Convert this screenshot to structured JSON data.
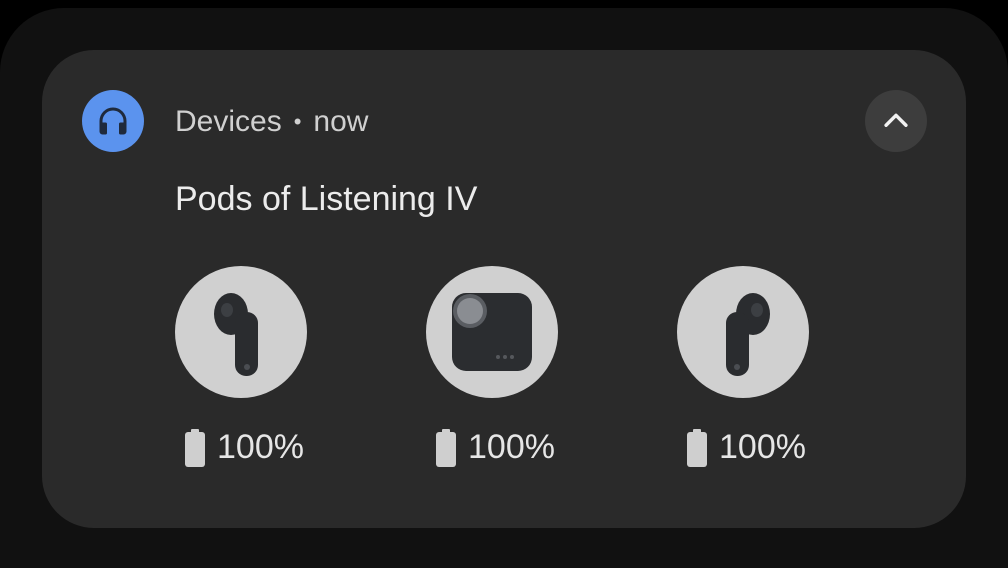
{
  "notification": {
    "app_name": "Devices",
    "separator": "•",
    "time": "now",
    "title": "Pods of Listening IV",
    "app_icon": "headphones-icon",
    "expand_icon": "chevron-up-icon",
    "accent_color": "#5b93ee"
  },
  "devices": [
    {
      "name": "left-earbud",
      "battery_label": "100%",
      "battery_level": 1.0
    },
    {
      "name": "charging-case",
      "battery_label": "100%",
      "battery_level": 1.0
    },
    {
      "name": "right-earbud",
      "battery_label": "100%",
      "battery_level": 1.0
    }
  ]
}
